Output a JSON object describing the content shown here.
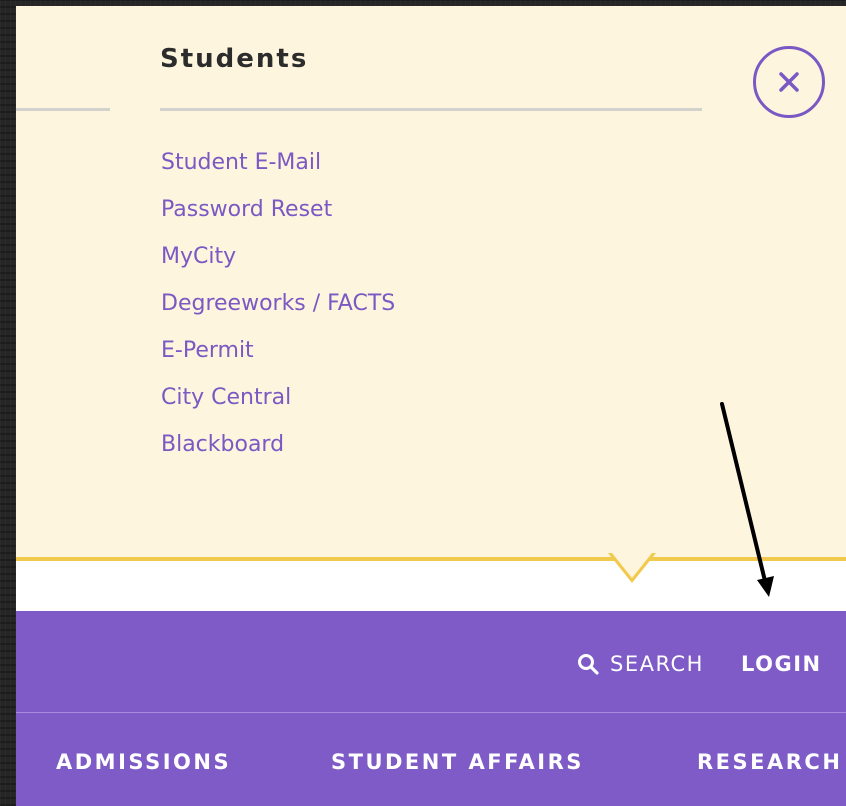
{
  "dropdown": {
    "heading": "Students",
    "links": [
      {
        "label": "Student E-Mail"
      },
      {
        "label": "Password Reset"
      },
      {
        "label": "MyCity"
      },
      {
        "label": "Degreeworks / FACTS"
      },
      {
        "label": "E-Permit"
      },
      {
        "label": "City Central"
      },
      {
        "label": "Blackboard"
      }
    ],
    "close_icon": "close-circle-icon"
  },
  "utility_nav": {
    "search_label": "SEARCH",
    "search_icon": "search-icon",
    "login_label": "LOGIN"
  },
  "main_nav": {
    "items": [
      {
        "label": "ADMISSIONS"
      },
      {
        "label": "STUDENT AFFAIRS"
      },
      {
        "label": "RESEARCH"
      }
    ]
  },
  "annotation": {
    "icon": "arrow-down-icon"
  },
  "colors": {
    "panel_background": "#fdf5dd",
    "accent_gold": "#f1c94e",
    "brand_purple": "#7e5bc6",
    "link_purple": "#7a59c4",
    "page_background": "#262626"
  }
}
